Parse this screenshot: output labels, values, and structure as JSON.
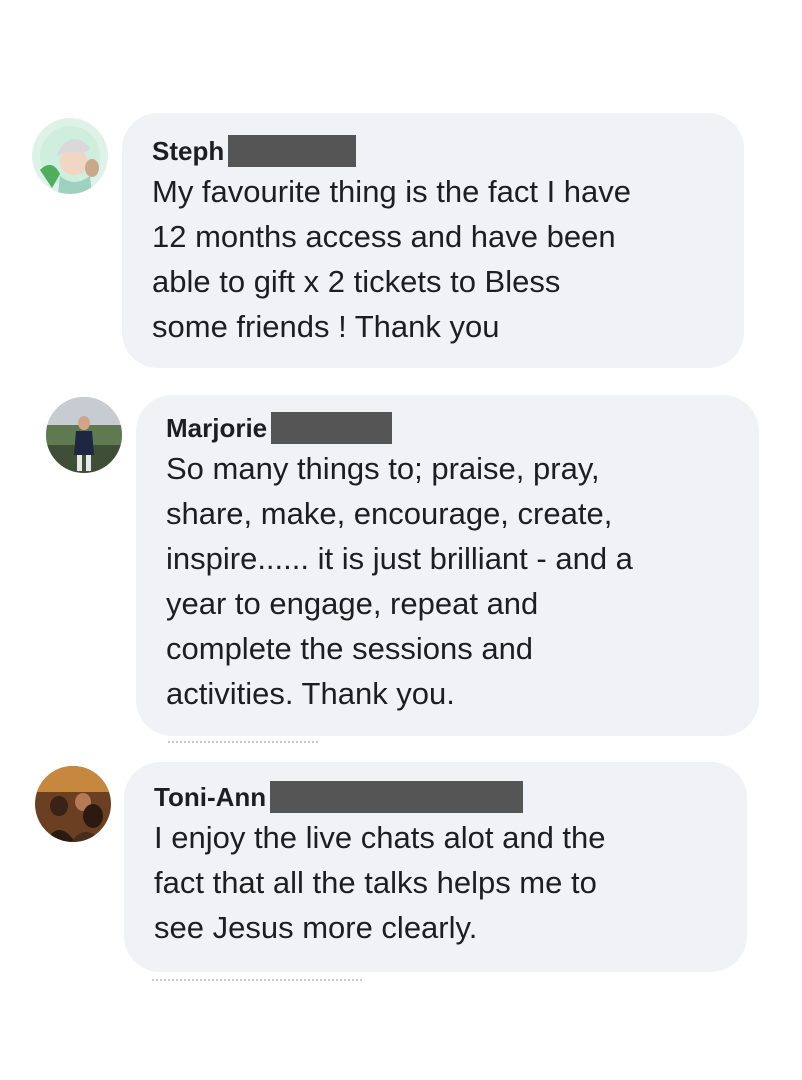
{
  "comments": [
    {
      "author": "Steph",
      "text": "My favourite thing is the fact I have\n12 months access and have been\nable to gift x 2 tickets to Bless\nsome friends ! Thank you"
    },
    {
      "author": "Marjorie",
      "text": "So many things to; praise, pray,\nshare, make, encourage, create,\ninspire...... it is just brilliant - and a\nyear to engage, repeat and\ncomplete the sessions and\nactivities. Thank you."
    },
    {
      "author": "Toni-Ann",
      "text": "I enjoy the live chats alot and the\nfact that all the talks helps me to\nsee Jesus more clearly."
    }
  ],
  "colors": {
    "bubble": "#f0f2f5",
    "redaction": "#555555",
    "text": "#1c1e21"
  }
}
